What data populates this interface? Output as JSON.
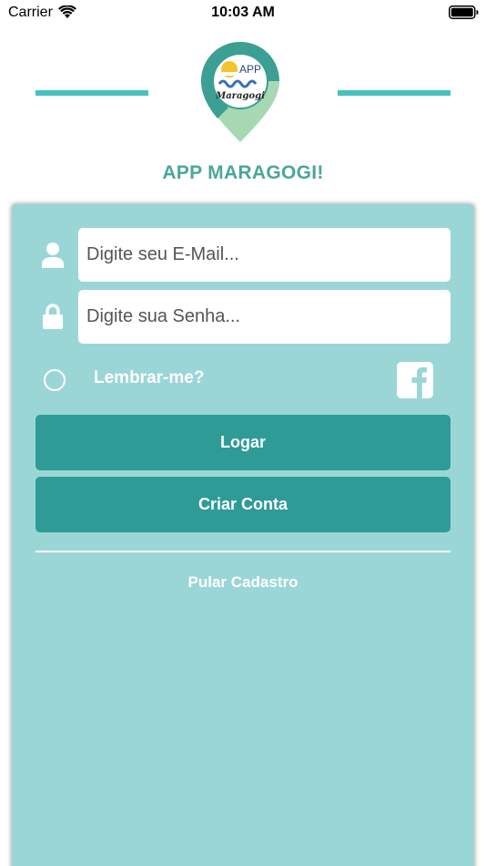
{
  "status_bar": {
    "carrier": "Carrier",
    "time": "10:03 AM",
    "wifi_icon": "wifi-icon",
    "battery_icon": "battery-icon"
  },
  "header": {
    "logo_top_text": "APP",
    "logo_script_text": "Maragogi",
    "title": "APP MARAGOGI!",
    "accent_color": "#45c2bf",
    "title_color": "#4aa79a"
  },
  "login_form": {
    "email": {
      "placeholder": "Digite seu E-Mail...",
      "value": "",
      "icon": "user-icon"
    },
    "password": {
      "placeholder": "Digite sua Senha...",
      "value": "",
      "icon": "lock-icon"
    },
    "remember_label": "Lembrar-me?",
    "facebook_icon": "facebook-icon",
    "login_button": "Logar",
    "create_account_button": "Criar Conta",
    "skip_link": "Pular Cadastro",
    "panel_color": "#9bd6d7",
    "button_color": "#2e9b97"
  }
}
